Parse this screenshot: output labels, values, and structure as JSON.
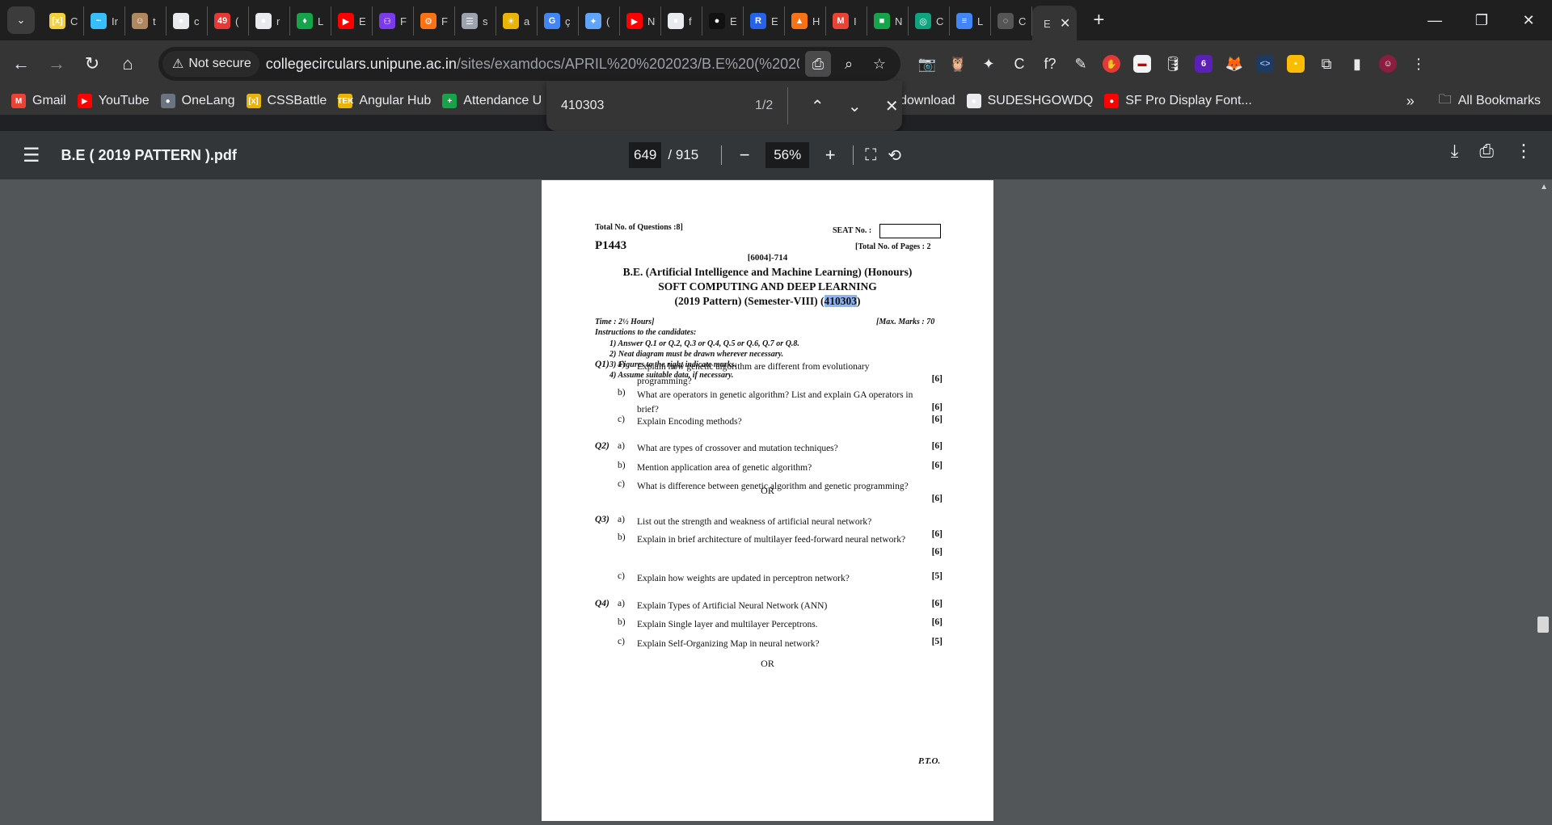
{
  "tabs": [
    {
      "icon": "[x]",
      "title": "C",
      "color": "#f4d03f"
    },
    {
      "icon": "~",
      "title": "Ir",
      "color": "#38bdf8"
    },
    {
      "icon": "☺",
      "title": "t",
      "color": "#b08860"
    },
    {
      "icon": "●",
      "title": "c",
      "color": "#e8eaed"
    },
    {
      "icon": "49",
      "title": "(",
      "color": "#e53935"
    },
    {
      "icon": "●",
      "title": "r",
      "color": "#e8eaed"
    },
    {
      "icon": "♦",
      "title": "L",
      "color": "#16a34a"
    },
    {
      "icon": "▶",
      "title": "E",
      "color": "#ff0000"
    },
    {
      "icon": "⚇",
      "title": "F",
      "color": "#7c3aed"
    },
    {
      "icon": "⚙",
      "title": "F",
      "color": "#f97316"
    },
    {
      "icon": "☰",
      "title": "s",
      "color": "#9ca3af"
    },
    {
      "icon": "☀",
      "title": "a",
      "color": "#eab308"
    },
    {
      "icon": "G",
      "title": "ç",
      "color": "#4285f4"
    },
    {
      "icon": "✦",
      "title": "(",
      "color": "#60a5fa"
    },
    {
      "icon": "▶",
      "title": "N",
      "color": "#ff0000"
    },
    {
      "icon": "●",
      "title": "f",
      "color": "#e8eaed"
    },
    {
      "icon": "●",
      "title": "E",
      "color": "#111111"
    },
    {
      "icon": "R",
      "title": "E",
      "color": "#2563eb"
    },
    {
      "icon": "▲",
      "title": "H",
      "color": "#f97316"
    },
    {
      "icon": "M",
      "title": "I",
      "color": "#ea4335"
    },
    {
      "icon": "■",
      "title": "N",
      "color": "#16a34a"
    },
    {
      "icon": "◎",
      "title": "C",
      "color": "#10a37f"
    },
    {
      "icon": "≡",
      "title": "L",
      "color": "#4285f4"
    },
    {
      "icon": "◌",
      "title": "C",
      "color": "#555555"
    }
  ],
  "active_tab": {
    "title": "E"
  },
  "toolbar": {
    "not_secure": "Not secure",
    "url_host": "collegecirculars.unipune.ac.in",
    "url_path": "/sites/examdocs/APRIL%20%202023/B.E%20(%202019..."
  },
  "bookmarks": [
    {
      "label": "Gmail",
      "icon": "M",
      "color": "#ea4335"
    },
    {
      "label": "YouTube",
      "icon": "▶",
      "color": "#ff0000"
    },
    {
      "label": "OneLang",
      "icon": "●",
      "color": "#6b7280"
    },
    {
      "label": "CSSBattle",
      "icon": "[x]",
      "color": "#eab308"
    },
    {
      "label": "Angular Hub",
      "icon": "TEK",
      "color": "#eab308"
    },
    {
      "label": "Attendance U",
      "icon": "+",
      "color": "#16a34a"
    },
    {
      "label": "yt download",
      "icon": "▶",
      "color": "#ff0000"
    },
    {
      "label": "SUDESHGOWDQ",
      "icon": "●",
      "color": "#e8eaed"
    },
    {
      "label": "SF Pro Display Font...",
      "icon": "●",
      "color": "#ff0000"
    }
  ],
  "bookmarks_more": "»",
  "all_bookmarks": "All Bookmarks",
  "find": {
    "query": "410303",
    "count": "1/2"
  },
  "pdf": {
    "title": "B.E ( 2019 PATTERN ).pdf",
    "page": "649",
    "total": "/ 915",
    "zoom": "56%"
  },
  "doc": {
    "total_questions": "Total No. of Questions :8]",
    "seat_no": "SEAT No. :",
    "paper_code": "P1443",
    "total_pages": "[Total No. of Pages : 2",
    "exam_code": "[6004]-714",
    "degree": "B.E. (Artificial Intelligence and Machine Learning) (Honours)",
    "subject": "SOFT COMPUTING AND DEEP LEARNING",
    "pattern_pre": "(2019 Pattern)  (Semester-VIII) (",
    "pattern_code": "410303",
    "pattern_post": ")",
    "time": "Time : 2½ Hours]",
    "max_marks": "[Max. Marks : 70",
    "instructions_heading": "Instructions to the candidates:",
    "instructions": [
      "1)    Answer Q.1 or Q.2, Q.3 or Q.4, Q.5 or Q.6, Q.7 or Q.8.",
      "2)    Neat diagram must be drawn wherever necessary.",
      "3)    Figures to the right indicate marks.",
      "4)    Assume suitable data, if necessary."
    ],
    "questions": [
      {
        "qn": "Q1)",
        "l": "a)",
        "t": "Explain how genetic algorithm are different from evolutionary programming?",
        "m": "[6]"
      },
      {
        "qn": "",
        "l": "b)",
        "t": "What are operators in genetic algorithm? List and explain GA operators in brief?",
        "m": "[6]"
      },
      {
        "qn": "",
        "l": "c)",
        "t": "Explain Encoding methods?",
        "m": "[6]"
      },
      {
        "qn": "Q2)",
        "l": "a)",
        "t": "What are types of crossover and mutation techniques?",
        "m": "[6]"
      },
      {
        "qn": "",
        "l": "b)",
        "t": "Mention application area of genetic algorithm?",
        "m": "[6]"
      },
      {
        "qn": "",
        "l": "c)",
        "t": "What is difference between genetic algorithm and genetic programming?",
        "m": "[6]"
      },
      {
        "qn": "Q3)",
        "l": "a)",
        "t": "List out the strength and weakness of artificial neural network?",
        "m": "[6]"
      },
      {
        "qn": "",
        "l": "b)",
        "t": "Explain in brief architecture of multilayer feed-forward neural network?",
        "m": "[6]"
      },
      {
        "qn": "",
        "l": "c)",
        "t": "Explain how weights are updated in perceptron network?",
        "m": "[5]"
      },
      {
        "qn": "Q4)",
        "l": "a)",
        "t": "Explain Types of Artificial Neural Network (ANN)",
        "m": "[6]"
      },
      {
        "qn": "",
        "l": "b)",
        "t": "Explain Single layer and multilayer Perceptrons.",
        "m": "[6]"
      },
      {
        "qn": "",
        "l": "c)",
        "t": "Explain Self-Organizing Map in neural network?",
        "m": "[5]"
      }
    ],
    "or": "OR",
    "pto": "P.T.O."
  }
}
